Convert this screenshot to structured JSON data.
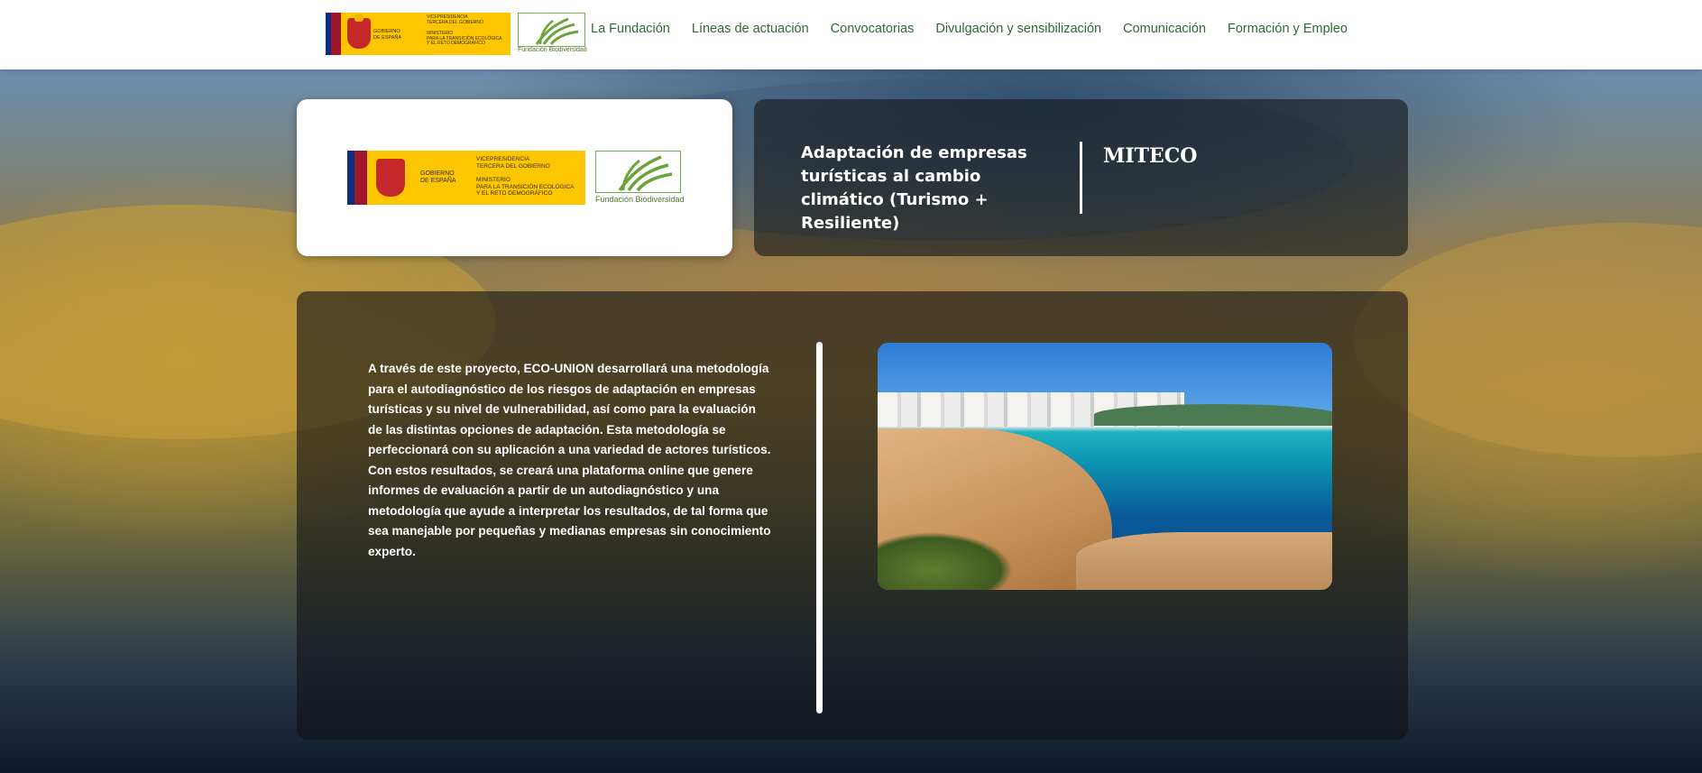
{
  "header": {
    "gov_logo": {
      "line1": "GOBIERNO",
      "line2": "DE ESPAÑA",
      "vp_line1": "VICEPRESIDENCIA",
      "vp_line2": "TERCERA DEL GOBIERNO",
      "min_line1": "MINISTERIO",
      "min_line2": "PARA LA TRANSICIÓN ECOLÓGICA",
      "min_line3": "Y EL RETO DEMOGRÁFICO"
    },
    "fb_logo": {
      "caption": "Fundación Biodiversidad"
    },
    "nav": [
      {
        "label": "La Fundación"
      },
      {
        "label": "Líneas de actuación"
      },
      {
        "label": "Convocatorias"
      },
      {
        "label": "Divulgación y sensibilización"
      },
      {
        "label": "Comunicación"
      },
      {
        "label": "Formación y Empleo"
      }
    ]
  },
  "project": {
    "title": "Adaptación de empresas turísticas al cambio climático (Turismo + Resiliente)",
    "organization": "MITECO",
    "description_before": "A través de este proyecto, ",
    "description_bold": "ECO-UNION",
    "description_after": " desarrollará una metodología para el autodiagnóstico de los riesgos de adaptación en empresas turísticas y su nivel de vulnerabilidad, así como para la evaluación de las distintas opciones de adaptación. Esta metodología se perfeccionará con su aplicación a una variedad de actores turísticos. Con estos resultados, se creará una plataforma online que genere informes de evaluación a partir de un autodiagnóstico y una metodología que ayude a interpretar los resultados, de tal forma que sea manejable por pequeñas y medianas empresas sin conocimiento experto."
  },
  "colors": {
    "nav_text": "#2f6a2f",
    "gov_yellow": "#fdc600",
    "card_dark": "#14181c"
  }
}
